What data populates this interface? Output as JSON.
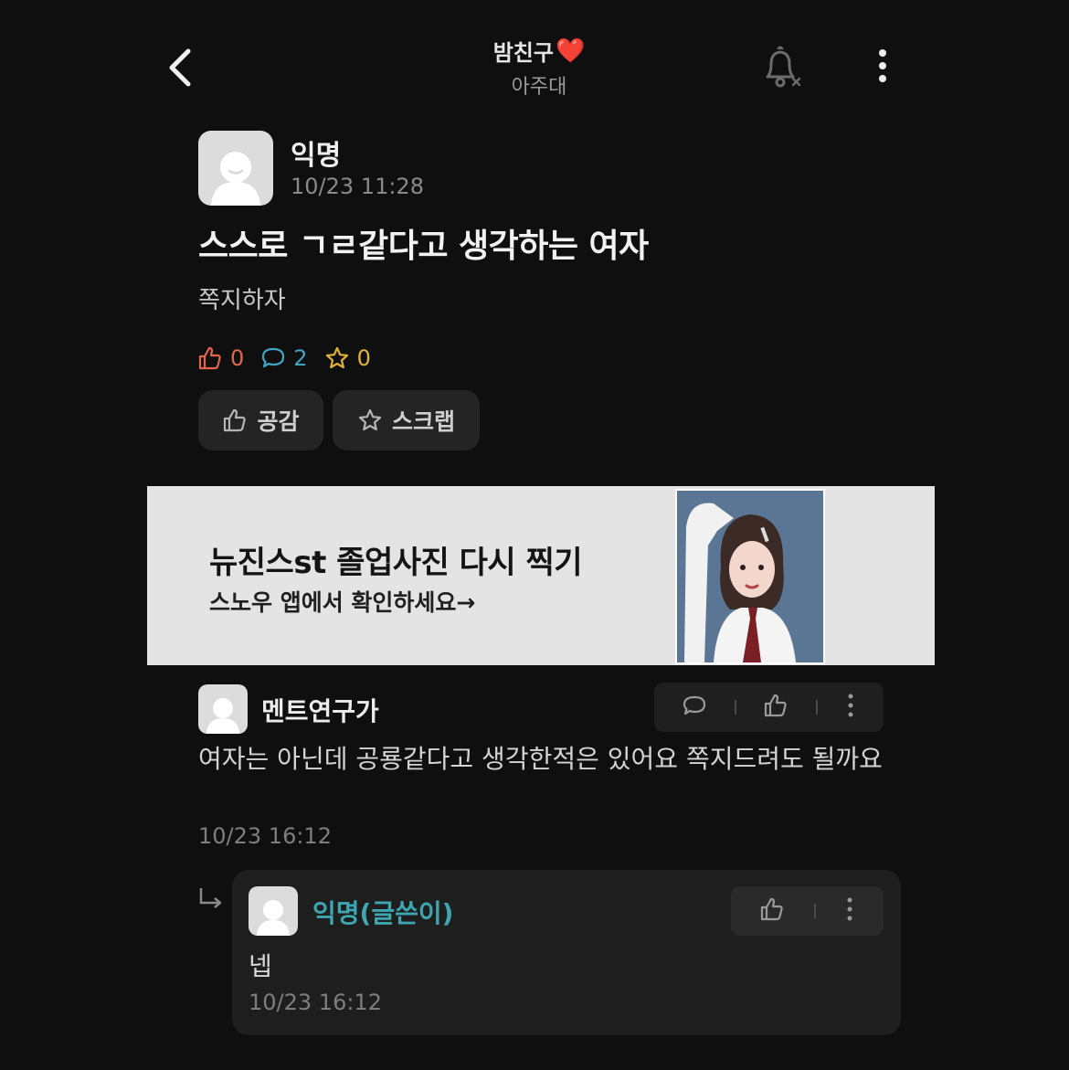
{
  "header": {
    "board_title": "밤친구",
    "heart": "❤️",
    "board_subtitle": "아주대"
  },
  "post": {
    "author": "익명",
    "time": "10/23 11:28",
    "title": "스스로 ㄱㄹ같다고 생각하는 여자",
    "body": "쪽지하자",
    "stats": {
      "likes": "0",
      "comments": "2",
      "scraps": "0"
    },
    "like_button_label": "공감",
    "scrap_button_label": "스크랩"
  },
  "ad": {
    "title": "뉴진스st 졸업사진 다시 찍기",
    "subtitle": "스노우 앱에서 확인하세요→"
  },
  "comment": {
    "author": "멘트연구가",
    "body": "여자는 아닌데 공룡같다고 생각한적은 있어요 쪽지드려도 될까요",
    "time": "10/23 16:12"
  },
  "reply": {
    "author": "익명(글쓴이)",
    "body": "넵",
    "time": "10/23 16:12"
  },
  "colors": {
    "background": "#0f0f10",
    "like": "#e2654c",
    "comment": "#43a3c4",
    "scrap": "#e0b43c",
    "op_author": "#3ea6b0"
  },
  "icons": {
    "back": "chevron-left-icon",
    "notification": "bell-off-icon",
    "more": "kebab-menu-icon",
    "like": "thumbs-up-icon",
    "comment": "speech-bubble-icon",
    "scrap": "star-icon",
    "reply": "reply-arrow-icon"
  }
}
